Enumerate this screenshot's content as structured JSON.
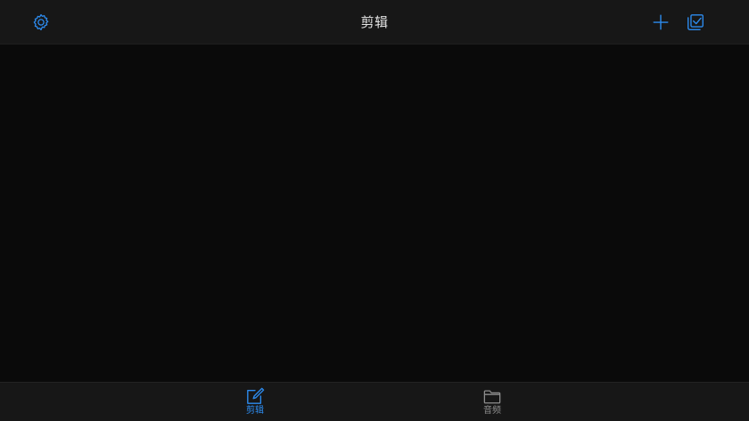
{
  "header": {
    "title": "剪辑",
    "left_icon": "gear-icon",
    "right_icons": [
      "plus-icon",
      "select-checkbox-icon"
    ]
  },
  "tabbar": {
    "tabs": [
      {
        "label": "剪辑",
        "icon": "edit-icon",
        "active": true
      },
      {
        "label": "音频",
        "icon": "folder-icon",
        "active": false
      }
    ]
  },
  "colors": {
    "accent": "#2d8cf0",
    "background": "#0a0a0a",
    "bar_background": "#171717",
    "title_text": "#e4e4e4",
    "inactive_tab": "#8e8e8e"
  }
}
